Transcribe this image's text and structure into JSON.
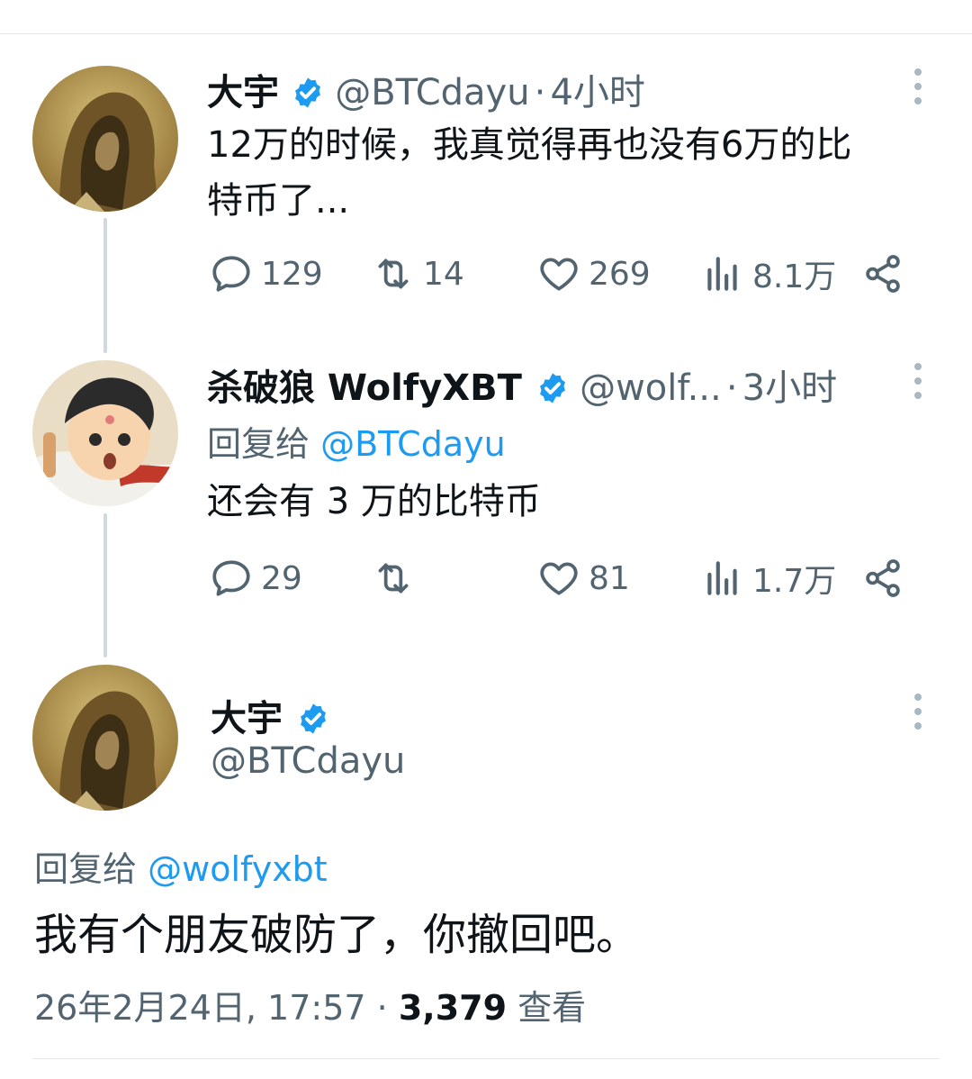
{
  "tweet1": {
    "name": "大宇",
    "handle": "@BTCdayu",
    "separator": "·",
    "time": "4小时",
    "text_line1": "12万的时候，我真觉得再也没有6万的比",
    "text_line2": "特币了...",
    "replies": "129",
    "retweets": "14",
    "likes": "269",
    "views": "8.1万"
  },
  "tweet2": {
    "name": "杀破狼 WolfyXBT",
    "handle": "@wolf...",
    "separator": "·",
    "time": "3小时",
    "reply_prefix": "回复给",
    "reply_handle": "@BTCdayu",
    "text": "还会有 3 万的比特币",
    "replies": "29",
    "retweets": "",
    "likes": "81",
    "views": "1.7万"
  },
  "tweet3": {
    "name": "大宇",
    "handle": "@BTCdayu",
    "reply_prefix": "回复给",
    "reply_handle": "@wolfyxbt",
    "text": "我有个朋友破防了，你撤回吧。",
    "date": "26年2月24日, 17:57",
    "separator": "·",
    "views_count": "3,379",
    "views_label": "查看"
  },
  "colors": {
    "verified_blue": "#1d9bf0",
    "link_blue": "#1d9bf0",
    "secondary_text": "#536471",
    "primary_text": "#0f1419"
  },
  "icons": [
    "reply-icon",
    "retweet-icon",
    "like-icon",
    "views-icon",
    "share-icon",
    "verified-icon",
    "more-icon"
  ]
}
